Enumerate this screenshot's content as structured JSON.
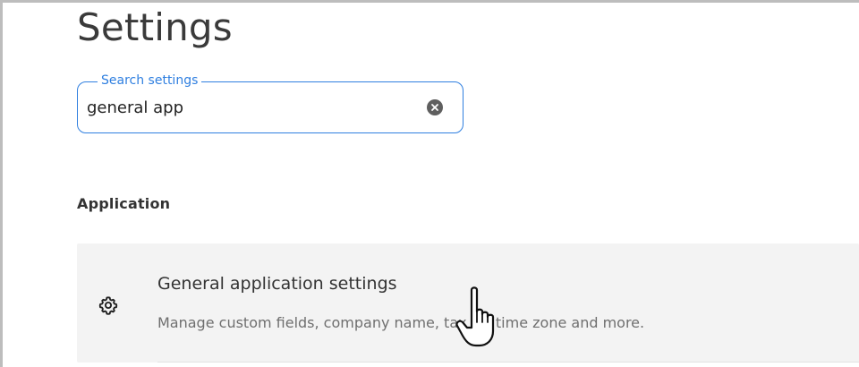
{
  "page": {
    "title": "Settings"
  },
  "search": {
    "label": "Search settings",
    "value": "general app",
    "clear_icon": "clear-circle-icon"
  },
  "results": {
    "section_heading": "Application",
    "items": [
      {
        "icon": "gear-icon",
        "title": "General application settings",
        "description": "Manage custom fields, company name, tax ID, time zone and more."
      }
    ]
  },
  "cursor": {
    "icon": "hand-pointer-cursor-icon"
  },
  "colors": {
    "accent": "#2f7fe0",
    "row_background": "#f3f3f3",
    "muted_text": "#6f6f6f"
  }
}
